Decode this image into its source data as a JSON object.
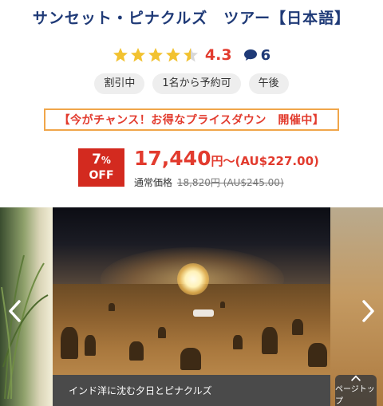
{
  "page": {
    "title": "サンセット・ピナクルズ　ツアー【日本語】"
  },
  "rating": {
    "stars": 4.5,
    "score": "4.3",
    "comments": "6",
    "star_color": "#f2c230",
    "icons": [
      "star-icon",
      "comment-icon"
    ]
  },
  "tags": [
    "割引中",
    "1名から予約可",
    "午後"
  ],
  "campaign": {
    "text": "【今がチャンス！お得なプライスダウン　開催中】",
    "border_color": "#f0a64a"
  },
  "discount": {
    "percent": "7",
    "percent_sign": "%",
    "off": "OFF",
    "color": "#d32a1f"
  },
  "price": {
    "value": "17,440",
    "unit": "円〜",
    "aud": "(AU$227.00)",
    "regular_label": "通常価格",
    "regular_value": "18,820円 (AU$245.00)",
    "color": "#e23b2e"
  },
  "gallery": {
    "caption": "インド洋に沈む夕日とピナクルズ",
    "prev_icon": "chevron-left-icon",
    "next_icon": "chevron-right-icon",
    "back_to_top": "ページトップ"
  }
}
